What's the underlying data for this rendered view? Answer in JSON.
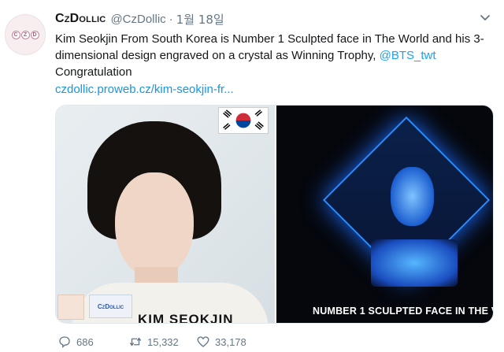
{
  "tweet": {
    "avatar_text": "CZD",
    "display_name": "CzDollic",
    "handle": "@CzDollic",
    "separator": "·",
    "date": "1월 18일",
    "text_main": "Kim Seokjin From South Korea is Number 1 Sculpted face in The World and his 3-dimensional design engraved on a crystal as Winning Trophy, ",
    "mention": "@BTS_twt",
    "text_after": "Congratulation",
    "link": "czdollic.proweb.cz/kim-seokjin-fr...",
    "media": {
      "left_logo": "CzDollic",
      "left_caption": "KIM SEOKJIN",
      "right_caption": "NUMBER 1 SCULPTED FACE IN THE V"
    },
    "actions": {
      "reply_count": "686",
      "retweet_count": "15,332",
      "like_count": "33,178"
    }
  },
  "icons": {
    "caret": "chevron-down-icon",
    "reply": "reply-icon",
    "retweet": "retweet-icon",
    "like": "heart-icon"
  },
  "colors": {
    "link": "#1b95e0",
    "secondary_text": "#657786"
  }
}
